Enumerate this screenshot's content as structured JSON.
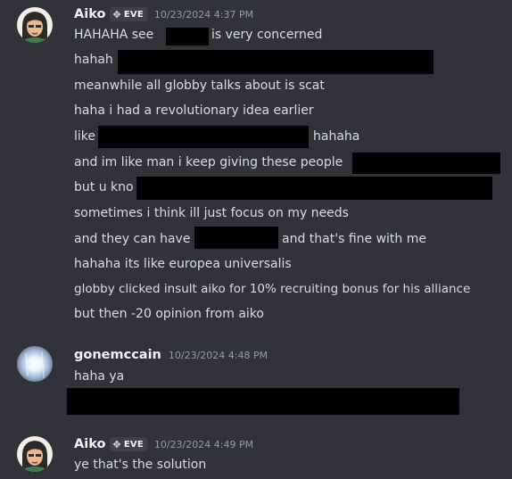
{
  "messages": [
    {
      "author": "Aiko",
      "tag": "EVE",
      "timestamp": "10/23/2024 4:37 PM",
      "lines": [
        {
          "text": "HAHAHA see"
        },
        {
          "text": "is very concerned"
        },
        {
          "text": "hahah"
        },
        {
          "text": "meanwhile all globby talks about is scat"
        },
        {
          "text": "haha i had a revolutionary idea earlier"
        },
        {
          "text": "like"
        },
        {
          "text": "hahaha"
        },
        {
          "text": "and im like man i keep giving these people"
        },
        {
          "text": "but u kno"
        },
        {
          "text": "sometimes i think ill just focus on my needs"
        },
        {
          "text": "and they can have"
        },
        {
          "text": "and that's fine with me"
        },
        {
          "text": "hahaha its  like europea universalis"
        },
        {
          "text": "globby clicked insult aiko for 10% recruiting bonus for his alliance"
        },
        {
          "text": "but then -20 opinion from aiko"
        }
      ]
    },
    {
      "author": "gonemccain",
      "timestamp": "10/23/2024 4:48 PM",
      "lines": [
        {
          "text": "haha ya"
        }
      ]
    },
    {
      "author": "Aiko",
      "tag": "EVE",
      "timestamp": "10/23/2024 4:49 PM",
      "lines": [
        {
          "text": "ye that's the solution"
        }
      ]
    }
  ],
  "colors": {
    "background": "#313338",
    "text": "#dbdee1",
    "timestamp": "#949ba4",
    "redaction": "#000000"
  },
  "icons": {
    "tag_icon": "diamond-badge-icon"
  }
}
